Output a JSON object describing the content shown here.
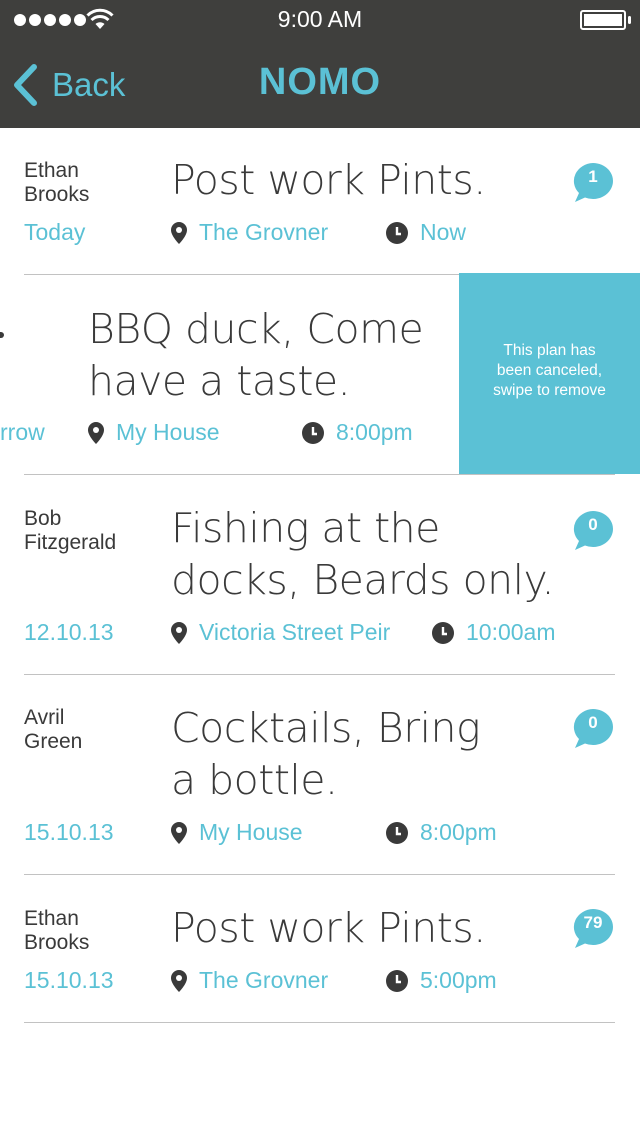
{
  "status_bar": {
    "time": "9:00 AM"
  },
  "nav": {
    "back_label": "Back",
    "title": "NOMO"
  },
  "colors": {
    "accent": "#5bc1d5",
    "header_bg": "#3f3f3d",
    "text": "#3a3a3a",
    "divider": "#c2c2c2"
  },
  "plans": [
    {
      "user": [
        "Ethan",
        "Brooks"
      ],
      "date": "Today",
      "title": [
        "Post work Pints."
      ],
      "location": "The Grovner",
      "time": "Now",
      "comments": "1"
    },
    {
      "user": [
        "",
        ""
      ],
      "date": "rrow",
      "title": [
        "BBQ duck, Come",
        "have a taste."
      ],
      "location": "My House",
      "time": "8:00pm",
      "comments": "",
      "swiped": true,
      "notice": [
        "This plan has",
        "been canceled,",
        "swipe to remove"
      ]
    },
    {
      "user": [
        "Bob",
        "Fitzgerald"
      ],
      "date": "12.10.13",
      "title": [
        "Fishing at the",
        "docks, Beards only."
      ],
      "location": "Victoria Street Peir",
      "time": "10:00am",
      "comments": "0"
    },
    {
      "user": [
        "Avril",
        "Green"
      ],
      "date": "15.10.13",
      "title": [
        "Cocktails, Bring",
        "a bottle."
      ],
      "location": "My House",
      "time": "8:00pm",
      "comments": "0"
    },
    {
      "user": [
        "Ethan",
        "Brooks"
      ],
      "date": "15.10.13",
      "title": [
        "Post work Pints."
      ],
      "location": "The Grovner",
      "time": "5:00pm",
      "comments": "79"
    }
  ]
}
